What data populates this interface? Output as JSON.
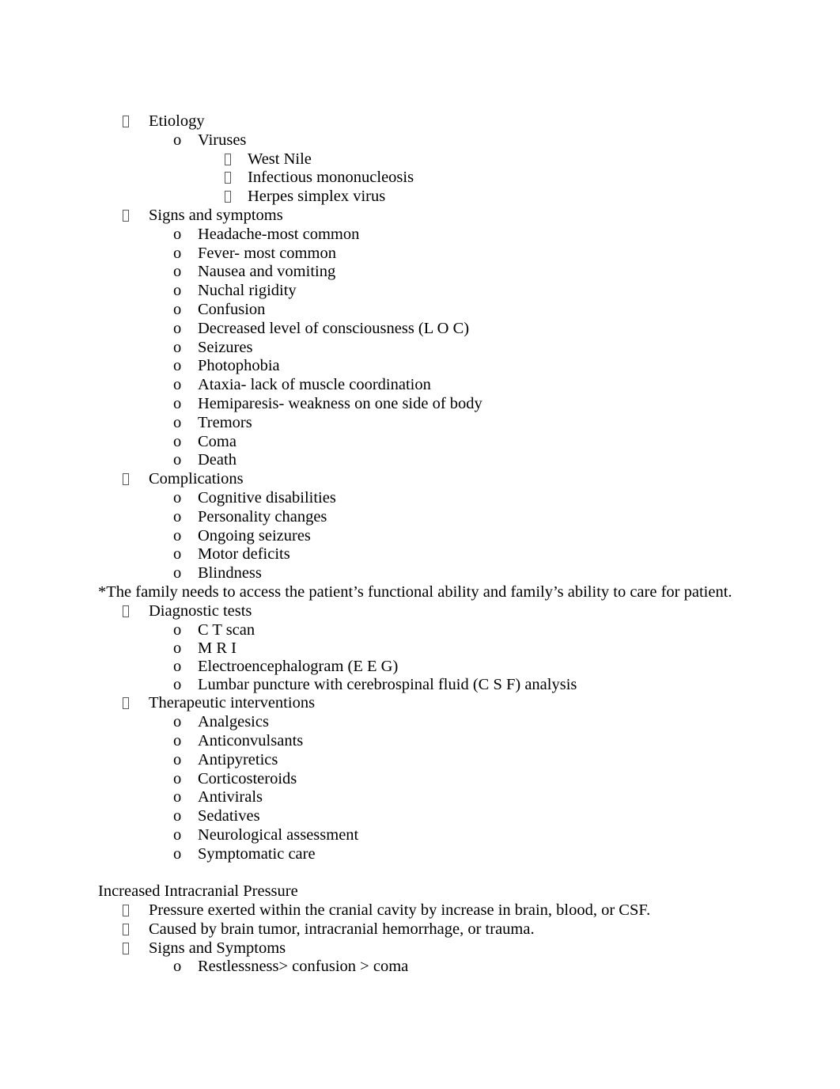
{
  "document": {
    "bullet_glyph": "tofu-box",
    "level2_marker": "o",
    "text_color": "#000000",
    "bullet_color": "#59595b",
    "background_color": "#ffffff",
    "blocks": [
      {
        "id": "etiology",
        "level": 1,
        "marker": "tofu",
        "text": "Etiology"
      },
      {
        "id": "viruses",
        "level": 2,
        "marker": "o",
        "text": "Viruses"
      },
      {
        "id": "west-nile",
        "level": 3,
        "marker": "tofu",
        "text": "West Nile"
      },
      {
        "id": "infectious-mononucleosis",
        "level": 3,
        "marker": "tofu",
        "text": "Infectious mononucleosis"
      },
      {
        "id": "herpes-simplex-virus",
        "level": 3,
        "marker": "tofu",
        "text": "Herpes simplex virus"
      },
      {
        "id": "signs-and-symptoms",
        "level": 1,
        "marker": "tofu",
        "text": "Signs and symptoms"
      },
      {
        "id": "headache",
        "level": 2,
        "marker": "o",
        "text": "Headache-most common"
      },
      {
        "id": "fever",
        "level": 2,
        "marker": "o",
        "text": "Fever- most common"
      },
      {
        "id": "nausea-and-vomiting",
        "level": 2,
        "marker": "o",
        "text": "Nausea and vomiting"
      },
      {
        "id": "nuchal-rigidity",
        "level": 2,
        "marker": "o",
        "text": "Nuchal rigidity"
      },
      {
        "id": "confusion",
        "level": 2,
        "marker": "o",
        "text": "Confusion"
      },
      {
        "id": "decreased-loc",
        "level": 2,
        "marker": "o",
        "text": "Decreased level of consciousness (L O C)"
      },
      {
        "id": "seizures",
        "level": 2,
        "marker": "o",
        "text": "Seizures"
      },
      {
        "id": "photophobia",
        "level": 2,
        "marker": "o",
        "text": "Photophobia"
      },
      {
        "id": "ataxia",
        "level": 2,
        "marker": "o",
        "text": "Ataxia- lack of muscle coordination"
      },
      {
        "id": "hemiparesis",
        "level": 2,
        "marker": "o",
        "text": "Hemiparesis- weakness on one side of body"
      },
      {
        "id": "tremors",
        "level": 2,
        "marker": "o",
        "text": "Tremors"
      },
      {
        "id": "coma",
        "level": 2,
        "marker": "o",
        "text": "Coma"
      },
      {
        "id": "death",
        "level": 2,
        "marker": "o",
        "text": "Death"
      },
      {
        "id": "complications",
        "level": 1,
        "marker": "tofu",
        "text": "Complications"
      },
      {
        "id": "cognitive-disabilities",
        "level": 2,
        "marker": "o",
        "text": "Cognitive disabilities"
      },
      {
        "id": "personality-changes",
        "level": 2,
        "marker": "o",
        "text": "Personality changes"
      },
      {
        "id": "ongoing-seizures",
        "level": 2,
        "marker": "o",
        "text": "Ongoing seizures"
      },
      {
        "id": "motor-deficits",
        "level": 2,
        "marker": "o",
        "text": "Motor deficits"
      },
      {
        "id": "blindness",
        "level": 2,
        "marker": "o",
        "text": "Blindness"
      },
      {
        "id": "family-note",
        "level": 0,
        "marker": "none",
        "text": "*The family needs to access the patient’s functional ability and family’s ability to care for patient."
      },
      {
        "id": "diagnostic-tests",
        "level": 1,
        "marker": "tofu",
        "text": "Diagnostic tests"
      },
      {
        "id": "ct-scan",
        "level": 2,
        "marker": "o",
        "text": "C T scan"
      },
      {
        "id": "mri",
        "level": 2,
        "marker": "o",
        "text": "M R I"
      },
      {
        "id": "eeg",
        "level": 2,
        "marker": "o",
        "text": "Electroencephalogram (E E G)"
      },
      {
        "id": "lumbar-puncture",
        "level": 2,
        "marker": "o",
        "text": "Lumbar puncture with cerebrospinal fluid (C S F) analysis"
      },
      {
        "id": "therapeutic-interventions",
        "level": 1,
        "marker": "tofu",
        "text": "Therapeutic interventions"
      },
      {
        "id": "analgesics",
        "level": 2,
        "marker": "o",
        "text": "Analgesics"
      },
      {
        "id": "anticonvulsants",
        "level": 2,
        "marker": "o",
        "text": "Anticonvulsants"
      },
      {
        "id": "antipyretics",
        "level": 2,
        "marker": "o",
        "text": "Antipyretics"
      },
      {
        "id": "corticosteroids",
        "level": 2,
        "marker": "o",
        "text": "Corticosteroids"
      },
      {
        "id": "antivirals",
        "level": 2,
        "marker": "o",
        "text": "Antivirals"
      },
      {
        "id": "sedatives",
        "level": 2,
        "marker": "o",
        "text": "Sedatives"
      },
      {
        "id": "neurological-assessment",
        "level": 2,
        "marker": "o",
        "text": "Neurological assessment"
      },
      {
        "id": "symptomatic-care",
        "level": 2,
        "marker": "o",
        "text": "Symptomatic care"
      },
      {
        "id": "spacer-1",
        "level": 0,
        "marker": "blank",
        "text": ""
      },
      {
        "id": "increased-icp-heading",
        "level": 0,
        "marker": "none",
        "text": "Increased Intracranial Pressure"
      },
      {
        "id": "icp-definition",
        "level": 1,
        "marker": "tofu",
        "text": "Pressure exerted within the cranial cavity by increase in brain, blood, or CSF."
      },
      {
        "id": "icp-causes",
        "level": 1,
        "marker": "tofu",
        "text": "Caused by brain tumor, intracranial hemorrhage, or trauma."
      },
      {
        "id": "icp-signs-and-symptoms",
        "level": 1,
        "marker": "tofu",
        "text": "Signs and Symptoms"
      },
      {
        "id": "icp-restlessness",
        "level": 2,
        "marker": "o",
        "text": "Restlessness> confusion > coma"
      }
    ]
  }
}
